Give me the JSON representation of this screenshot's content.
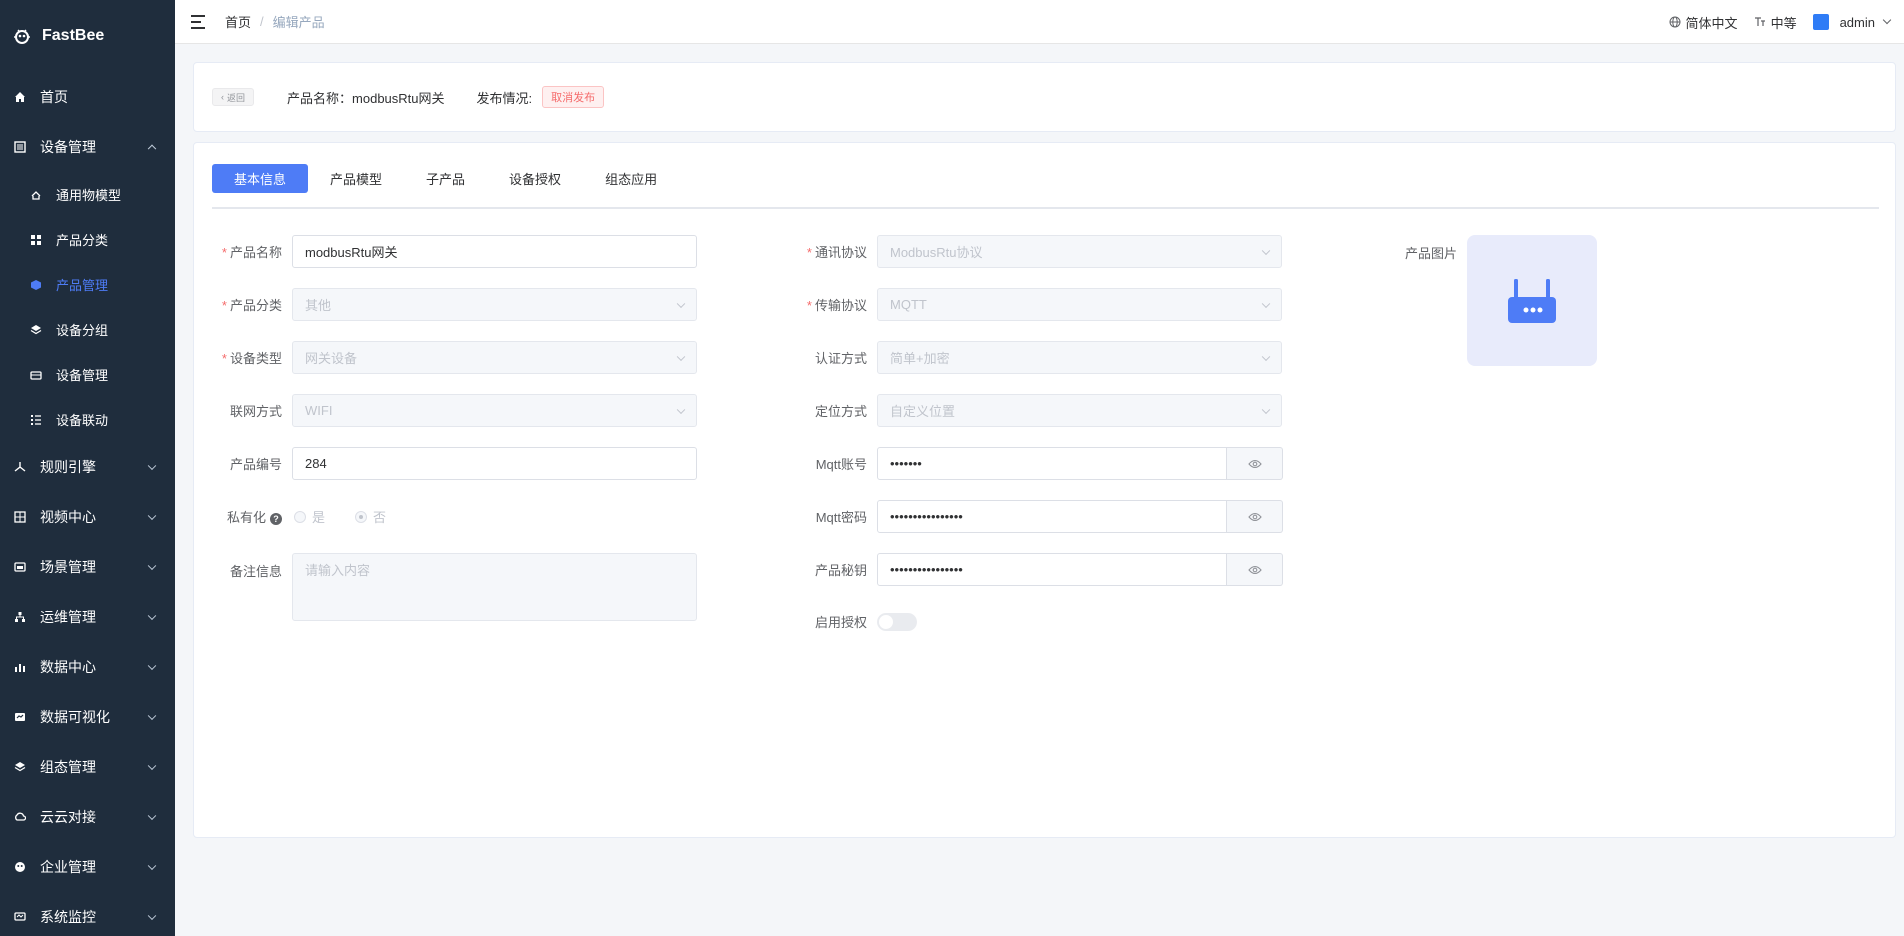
{
  "sidebar": {
    "brand": "FastBee",
    "items": [
      {
        "label": "首页"
      },
      {
        "label": "设备管理"
      },
      {
        "label": "规则引擎"
      },
      {
        "label": "视频中心"
      },
      {
        "label": "场景管理"
      },
      {
        "label": "运维管理"
      },
      {
        "label": "数据中心"
      },
      {
        "label": "数据可视化"
      },
      {
        "label": "组态管理"
      },
      {
        "label": "云云对接"
      },
      {
        "label": "企业管理"
      },
      {
        "label": "系统监控"
      }
    ],
    "sub_items": [
      {
        "label": "通用物模型"
      },
      {
        "label": "产品分类"
      },
      {
        "label": "产品管理"
      },
      {
        "label": "设备分组"
      },
      {
        "label": "设备管理"
      },
      {
        "label": "设备联动"
      }
    ]
  },
  "header": {
    "breadcrumb_home": "首页",
    "breadcrumb_sep": "/",
    "breadcrumb_current": "编辑产品",
    "language": "简体中文",
    "size": "中等",
    "user": "admin"
  },
  "top_card": {
    "back": "返回",
    "product_name_label": "产品名称：",
    "product_name": "modbusRtu网关",
    "publish_label": "发布情况:",
    "publish_tag": "取消发布"
  },
  "tabs": [
    "基本信息",
    "产品模型",
    "子产品",
    "设备授权",
    "组态应用"
  ],
  "form": {
    "product_name_label": "产品名称",
    "product_name_value": "modbusRtu网关",
    "category_label": "产品分类",
    "category_value": "其他",
    "device_type_label": "设备类型",
    "device_type_value": "网关设备",
    "network_label": "联网方式",
    "network_value": "WIFI",
    "product_no_label": "产品编号",
    "product_no_value": "284",
    "private_label": "私有化",
    "private_yes": "是",
    "private_no": "否",
    "remark_label": "备注信息",
    "remark_placeholder": "请输入内容",
    "protocol_label": "通讯协议",
    "protocol_value": "ModbusRtu协议",
    "transport_label": "传输协议",
    "transport_value": "MQTT",
    "auth_label": "认证方式",
    "auth_value": "简单+加密",
    "location_label": "定位方式",
    "location_value": "自定义位置",
    "mqtt_account_label": "Mqtt账号",
    "mqtt_account_value": "•••••••",
    "mqtt_password_label": "Mqtt密码",
    "mqtt_password_value": "••••••••••••••••",
    "secret_label": "产品秘钥",
    "secret_value": "••••••••••••••••",
    "enable_auth_label": "启用授权",
    "image_label": "产品图片"
  },
  "colors": {
    "sidebar_bg": "#1f2d3d",
    "accent": "#4e7cf6",
    "danger": "#f56c6c"
  }
}
